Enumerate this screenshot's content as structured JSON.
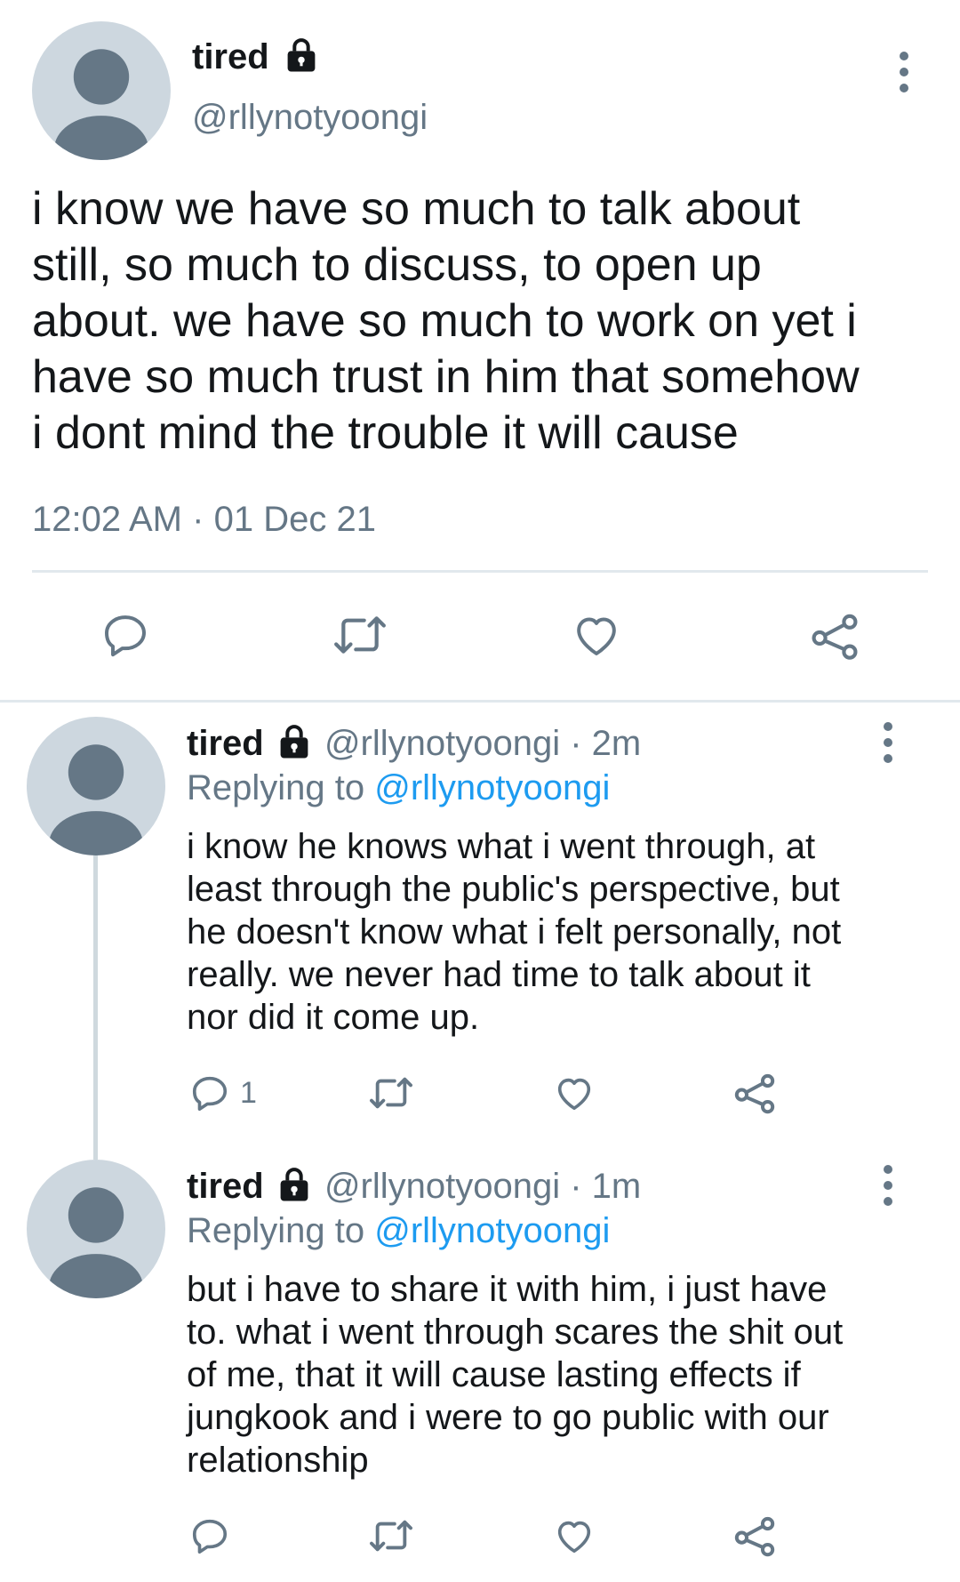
{
  "main_tweet": {
    "display_name": "tired",
    "handle": "@rllynotyoongi",
    "text_lines": [
      "i know we have so much to talk about",
      "still, so much to discuss, to open up",
      "about. we have so much to work on yet i",
      "have so much trust in him that somehow",
      "i dont mind the trouble it will cause"
    ],
    "time": "12:02 AM",
    "separator": "·",
    "date": "01 Dec 21",
    "actions": [
      "reply-icon",
      "retweet-icon",
      "like-icon",
      "share-icon"
    ]
  },
  "replies": [
    {
      "display_name": "tired",
      "handle": "@rllynotyoongi",
      "age": "· 2m",
      "replying_prefix": "Replying to ",
      "replying_to": "@rllynotyoongi",
      "text_lines": [
        "i know he knows what i went through, at",
        "least through the public's perspective, but",
        "he doesn't know what i felt personally, not",
        "really. we never had time to talk about it",
        "nor did it come up."
      ],
      "reply_count": "1"
    },
    {
      "display_name": "tired",
      "handle": "@rllynotyoongi",
      "age": "· 1m",
      "replying_prefix": "Replying to ",
      "replying_to": "@rllynotyoongi",
      "text_lines": [
        "but i have to share it with him, i just have",
        "to. what i went through scares the shit out",
        "of me, that it will cause lasting effects if",
        "jungkook and i were to go public with our",
        "relationship"
      ],
      "reply_count": ""
    }
  ],
  "colors": {
    "text": "#14171a",
    "secondary": "#657786",
    "link": "#1d9bf0",
    "avatar_bg": "#cdd7df",
    "avatar_fg": "#657786"
  }
}
